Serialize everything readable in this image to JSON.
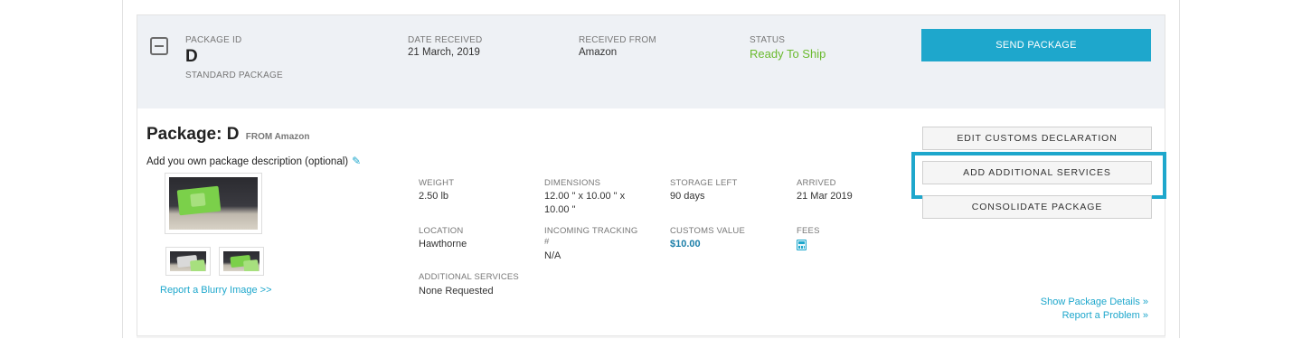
{
  "summary": {
    "package_id_label": "PACKAGE ID",
    "package_id": "D",
    "package_type": "STANDARD PACKAGE",
    "date_received_label": "DATE RECEIVED",
    "date_received": "21 March, 2019",
    "received_from_label": "RECEIVED FROM",
    "received_from": "Amazon",
    "status_label": "STATUS",
    "status": "Ready To Ship",
    "status_color": "#6aba2e",
    "send_button": "SEND PACKAGE",
    "accent_color": "#1ea7cc"
  },
  "details": {
    "title": "Package: D",
    "from_text": "FROM Amazon",
    "description_prompt": "Add you own package description (optional)",
    "report_blurry": "Report a Blurry Image >>",
    "fields": {
      "weight_label": "WEIGHT",
      "weight": "2.50 lb",
      "dimensions_label": "DIMENSIONS",
      "dimensions_line1": "12.00 \" x 10.00 \" x",
      "dimensions_line2": "10.00 \"",
      "storage_left_label": "STORAGE LEFT",
      "storage_left": "90 days",
      "arrived_label": "ARRIVED",
      "arrived": "21 Mar 2019",
      "location_label": "LOCATION",
      "location": "Hawthorne",
      "incoming_tracking_label_line1": "INCOMING TRACKING",
      "incoming_tracking_label_line2": "#",
      "incoming_tracking": "N/A",
      "customs_value_label": "CUSTOMS VALUE",
      "customs_value": "$10.00",
      "fees_label": "FEES",
      "additional_services_label": "ADDITIONAL SERVICES",
      "additional_services": "None Requested"
    },
    "actions": {
      "edit_customs": "EDIT CUSTOMS DECLARATION",
      "add_services": "ADD ADDITIONAL SERVICES",
      "consolidate": "CONSOLIDATE PACKAGE"
    },
    "show_details": "Show Package Details »",
    "report_problem": "Report a Problem »"
  },
  "icons": {
    "collapse": "minus-square-icon",
    "edit": "pencil-icon",
    "fees": "calculator-icon"
  }
}
